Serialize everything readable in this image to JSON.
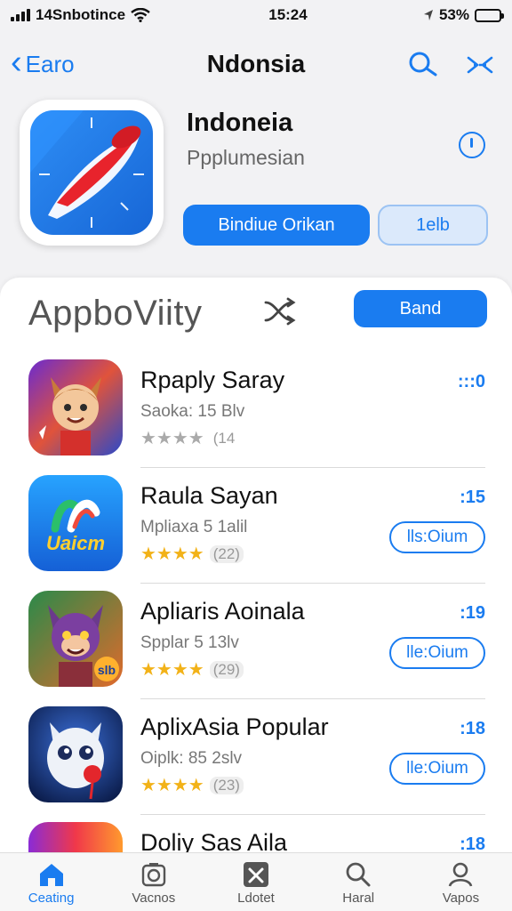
{
  "status_bar": {
    "carrier": "14Snbotince",
    "time": "15:24",
    "battery": "53%",
    "battery_level": 0.53
  },
  "nav": {
    "back_label": "Earo",
    "title": "Ndonsia",
    "icons": [
      "search-icon",
      "share-icon"
    ]
  },
  "app": {
    "name": "Indoneia",
    "subtitle": "Ppplumesian",
    "primary_button": "Bindiue Orikan",
    "secondary_button": "1elb"
  },
  "panel": {
    "title": "AppboViity",
    "button": "Band"
  },
  "items": [
    {
      "name": "Rpaply Saray",
      "meta": "Saoka: 15 Blv",
      "stars": "★★★★",
      "count": "(14",
      "time": ":::0",
      "action": "",
      "stars_grey": true
    },
    {
      "name": "Raula Sayan",
      "meta": "Mpliaxa 5 1alil",
      "stars": "★★★★",
      "count": "(22)",
      "time": ":15",
      "action": "lls:Oium",
      "stars_grey": false
    },
    {
      "name": "Apliaris Aoinala",
      "meta": "Spplar 5 13lv",
      "stars": "★★★★",
      "count": "(29)",
      "time": ":19",
      "action": "lle:Oium",
      "stars_grey": false
    },
    {
      "name": "AplixAsia Popular",
      "meta": "Oiplk: 85 2slv",
      "stars": "★★★★",
      "count": "(23)",
      "time": ":18",
      "action": "lle:Oium",
      "stars_grey": false
    },
    {
      "name": "Doliy Sas Aila",
      "meta": "",
      "stars": "",
      "count": "",
      "time": ":18",
      "action": "",
      "stars_grey": false
    }
  ],
  "tabs": [
    {
      "label": "Ceating",
      "icon": "home-icon"
    },
    {
      "label": "Vacnos",
      "icon": "camera-icon"
    },
    {
      "label": "Ldotet",
      "icon": "tools-icon"
    },
    {
      "label": "Haral",
      "icon": "search-icon"
    },
    {
      "label": "Vapos",
      "icon": "profile-icon"
    }
  ],
  "colors": {
    "accent": "#1a7cf0",
    "star": "#f2b218"
  }
}
